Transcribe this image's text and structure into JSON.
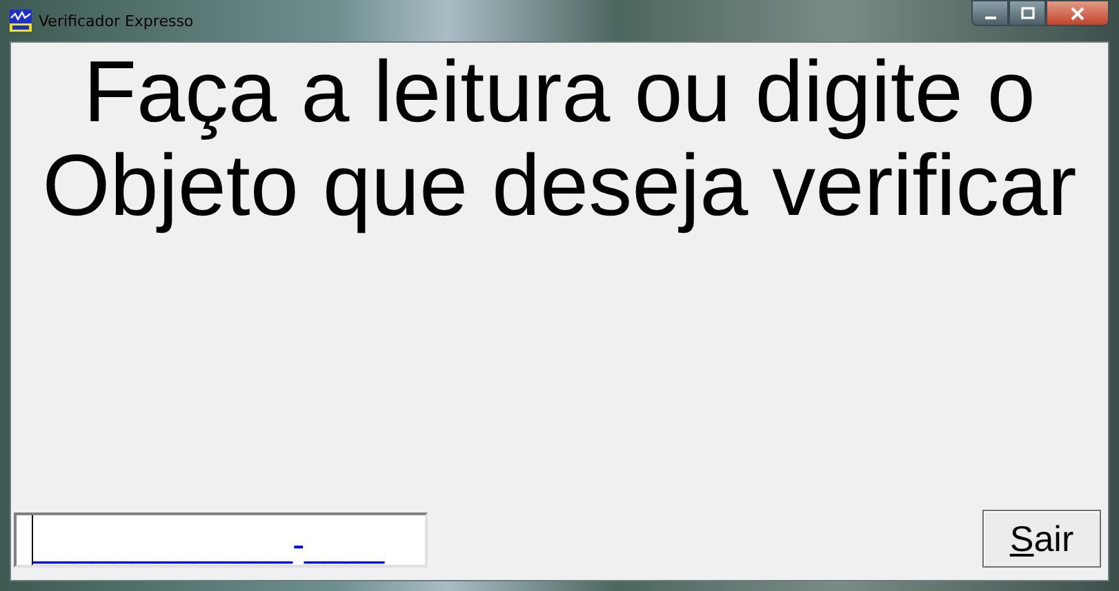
{
  "window": {
    "title": "Verificador Expresso"
  },
  "prompt": [
    "Faça a leitura ou digite o",
    "Objeto que deseja verificar"
  ],
  "object_field": {
    "value": "_____________-____"
  },
  "exit_button": {
    "label": "Sair",
    "first_letter_underlined": true
  }
}
